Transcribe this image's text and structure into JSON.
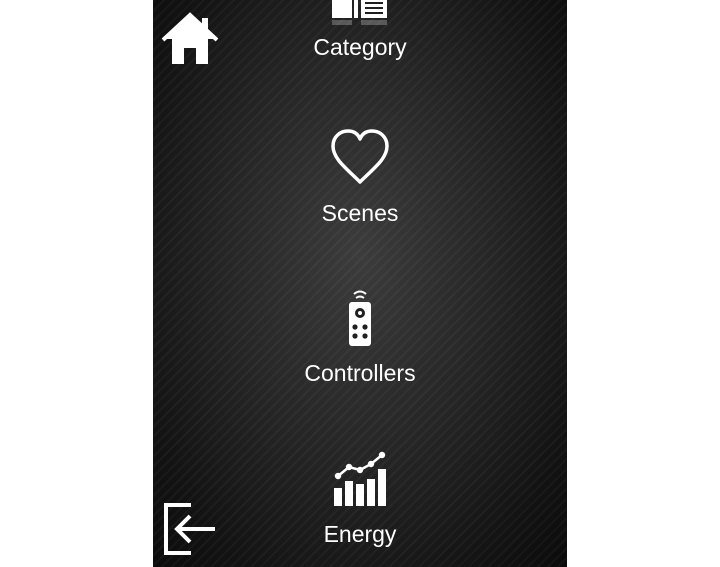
{
  "app": {
    "home_icon": "home-icon",
    "exit_icon": "exit-icon"
  },
  "menu": {
    "items": [
      {
        "label": "Category",
        "icon": "category-icon"
      },
      {
        "label": "Scenes",
        "icon": "heart-icon"
      },
      {
        "label": "Controllers",
        "icon": "remote-control-icon"
      },
      {
        "label": "Energy",
        "icon": "energy-chart-icon"
      }
    ]
  },
  "colors": {
    "background": "#1e1e1e",
    "foreground": "#ffffff",
    "page": "#ffffff"
  }
}
